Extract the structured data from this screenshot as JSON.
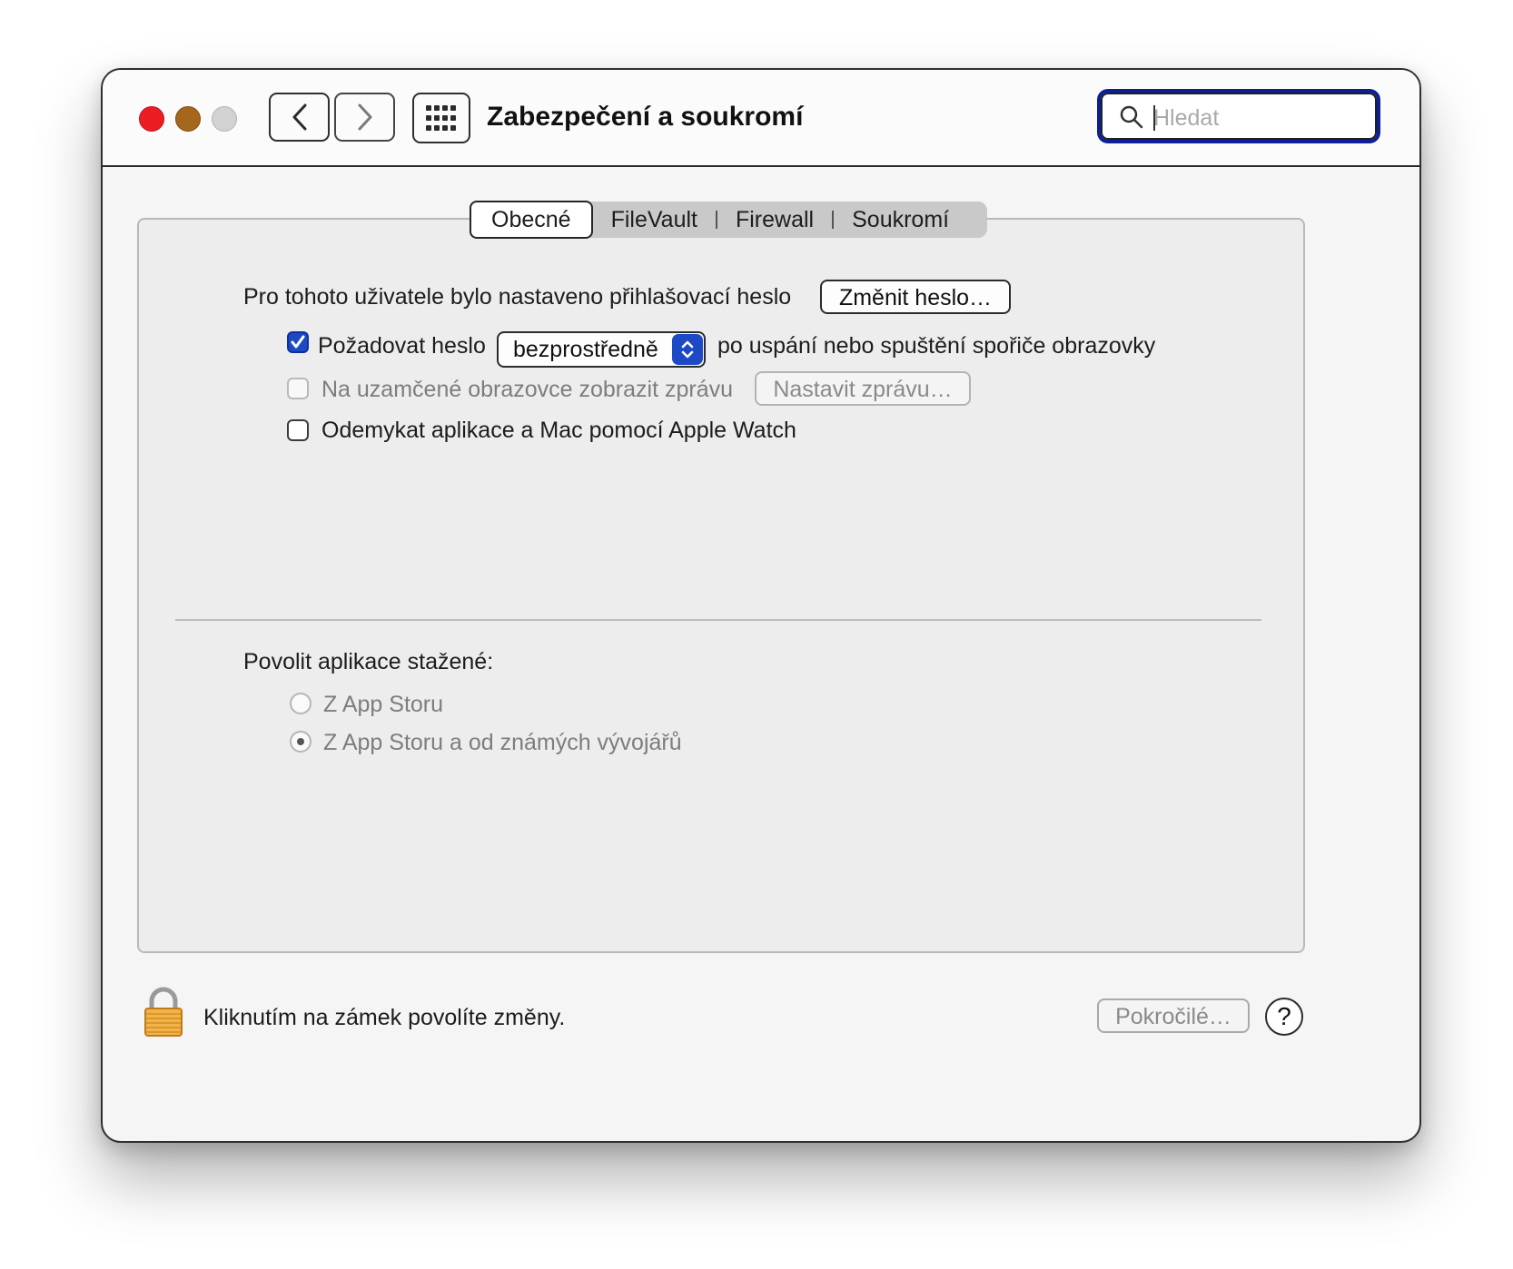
{
  "window": {
    "title": "Zabezpečení a soukromí"
  },
  "search": {
    "placeholder": "Hledat",
    "value": ""
  },
  "tabs": [
    {
      "label": "Obecné",
      "active": true
    },
    {
      "label": "FileVault",
      "active": false
    },
    {
      "label": "Firewall",
      "active": false
    },
    {
      "label": "Soukromí",
      "active": false
    }
  ],
  "general": {
    "password_set_text": "Pro tohoto uživatele bylo nastaveno přihlašovací heslo",
    "change_password_button": "Změnit heslo…",
    "require_password": {
      "label": "Požadovat heslo",
      "checked": true,
      "select_value": "bezprostředně",
      "suffix": "po uspání nebo spuštění spořiče obrazovky"
    },
    "lock_message": {
      "label": "Na uzamčené obrazovce zobrazit zprávu",
      "checked": false,
      "enabled": false,
      "button": "Nastavit zprávu…"
    },
    "apple_watch": {
      "label": "Odemykat aplikace a Mac pomocí Apple Watch",
      "checked": false
    }
  },
  "downloads": {
    "heading": "Povolit aplikace stažené:",
    "options": [
      {
        "label": "Z App Storu",
        "selected": false
      },
      {
        "label": "Z App Storu a od známých vývojářů",
        "selected": true
      }
    ]
  },
  "footer": {
    "lock_text": "Kliknutím na zámek povolíte změny.",
    "advanced_button": "Pokročilé…",
    "help_label": "?"
  },
  "colors": {
    "accent": "#1d49c7",
    "focus_ring": "#0c1f96",
    "close": "#ec1c24",
    "minimize": "#a4671c",
    "zoom": "#d2d2d2"
  },
  "icons": [
    "close-icon",
    "minimize-icon",
    "zoom-icon",
    "chevron-left-icon",
    "chevron-right-icon",
    "grid-icon",
    "search-icon",
    "checkmark-icon",
    "chevron-updown-icon",
    "lock-icon",
    "help-icon"
  ]
}
